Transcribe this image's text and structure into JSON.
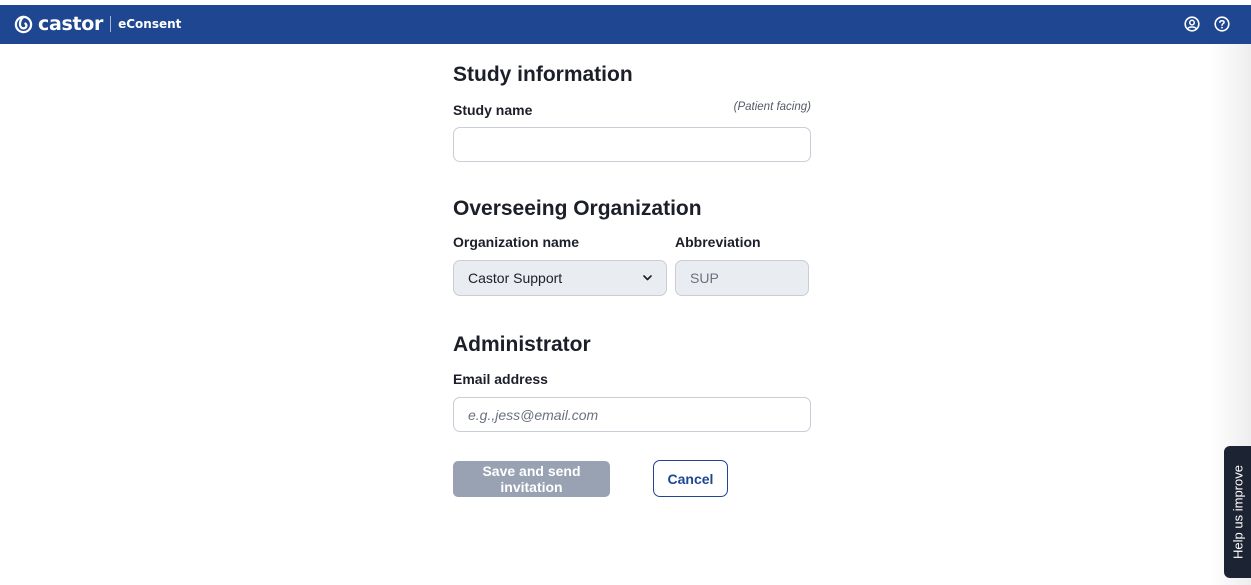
{
  "header": {
    "brand_name": "castor",
    "product_name": "eConsent",
    "icons": [
      "account-icon",
      "help-icon"
    ]
  },
  "study_information": {
    "title": "Study information",
    "study_name_label": "Study name",
    "study_name_hint": "(Patient facing)",
    "study_name_value": ""
  },
  "overseeing_organization": {
    "title": "Overseeing Organization",
    "organization_label": "Organization name",
    "organization_selected": "Castor Support",
    "abbreviation_label": "Abbreviation",
    "abbreviation_value": "SUP"
  },
  "administrator": {
    "title": "Administrator",
    "email_label": "Email address",
    "email_placeholder": "e.g.,jess@email.com",
    "email_value": ""
  },
  "actions": {
    "save_label": "Save and send invitation",
    "cancel_label": "Cancel"
  },
  "feedback": {
    "label": "Help us improve"
  },
  "colors": {
    "header_bg": "#1e4691",
    "primary_disabled": "#98a2b3",
    "secondary_border": "#1e4691",
    "feedback_bg": "#1c2333"
  }
}
